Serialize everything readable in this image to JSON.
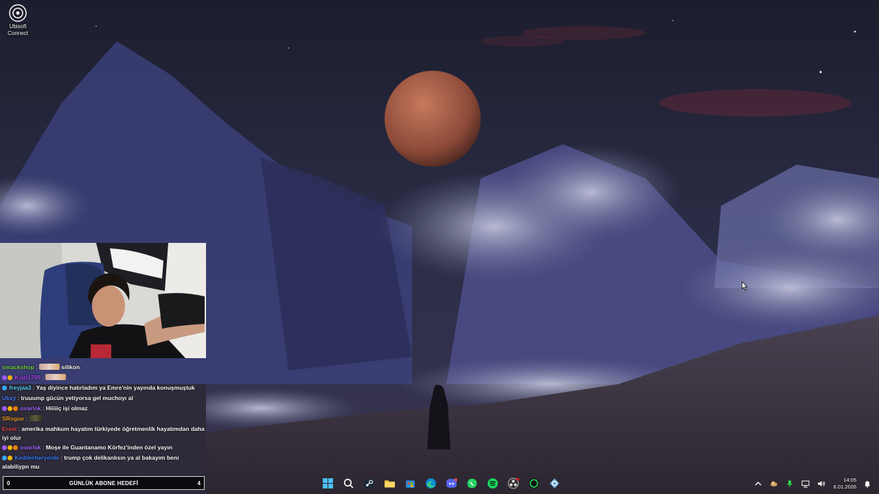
{
  "desktop": {
    "icons": [
      {
        "label": "Ubisoft Connect",
        "icon": "ubisoft-connect-icon"
      }
    ]
  },
  "chat": {
    "messages": [
      {
        "user": "smackshop",
        "user_color": "#7cd957",
        "badges": [],
        "text": "silikon",
        "emote": "emote"
      },
      {
        "user": "Kiari1709",
        "user_color": "#b34cff",
        "badges": [
          "#a05cff",
          "#f0b400"
        ],
        "text": "",
        "emote": "emote"
      },
      {
        "user": "freyjaa3",
        "user_color": "#5ad7ff",
        "badges": [
          "#38a8ff"
        ],
        "text": "Yaş diyince hatırladım ya Emre'nin yayında konuşmuştuk",
        "emote": ""
      },
      {
        "user": "Ubzy",
        "user_color": "#4a7dff",
        "badges": [],
        "text": "truuump gücün yetiyorsa gel muchoyı al",
        "emote": ""
      },
      {
        "user": "ovarlok",
        "user_color": "#a66bff",
        "badges": [
          "#a05cff",
          "#f0b400",
          "#f07c00"
        ],
        "text": "Hiiiiiç işi olmaz",
        "emote": ""
      },
      {
        "user": "SRogue",
        "user_color": "#e09a2a",
        "badges": [],
        "text": "",
        "emote": "emote-dark"
      },
      {
        "user": "Ersoi",
        "user_color": "#e9544a",
        "badges": [],
        "text": "amerika mahkum hayatım türkiyede öğretmenlik hayatımdan daha iyi olur",
        "emote": ""
      },
      {
        "user": "ovarlok",
        "user_color": "#a66bff",
        "badges": [
          "#a05cff",
          "#f0b400",
          "#f07c00"
        ],
        "text": "Moşe ile Guantanamo Körfez'inden özel yayın",
        "emote": ""
      },
      {
        "user": "Kedilerheryerde",
        "user_color": "#3e7fff",
        "badges": [
          "#38a8ff",
          "#f0b400"
        ],
        "text": "trump çok delikanlısın ya al bakayım beni alabiliypn mu",
        "emote": ""
      }
    ]
  },
  "goal": {
    "left": "0",
    "label": "GÜNLÜK ABONE HEDEFİ",
    "right": "4"
  },
  "taskbar": {
    "apps": [
      {
        "name": "start-button",
        "icon": "windows-icon"
      },
      {
        "name": "search-button",
        "icon": "search-icon"
      },
      {
        "name": "steam-button",
        "icon": "steam-icon"
      },
      {
        "name": "file-explorer-button",
        "icon": "folder-icon"
      },
      {
        "name": "store-button",
        "icon": "store-icon"
      },
      {
        "name": "edge-button",
        "icon": "edge-icon"
      },
      {
        "name": "discord-button",
        "icon": "discord-icon"
      },
      {
        "name": "whatsapp-button",
        "icon": "whatsapp-icon"
      },
      {
        "name": "spotify-button",
        "icon": "spotify-icon"
      },
      {
        "name": "obs-button",
        "icon": "obs-icon"
      },
      {
        "name": "xbox-button",
        "icon": "xbox-icon"
      },
      {
        "name": "ubisoft-button",
        "icon": "ubisoft-icon"
      }
    ],
    "clock": {
      "time": "14:05",
      "date": "6.01.2026"
    }
  },
  "colors": {
    "goal_bg": "#0b0b0f",
    "goal_border": "#d9d9d9",
    "sky": "#1e2034",
    "moon": "#b0614a"
  }
}
